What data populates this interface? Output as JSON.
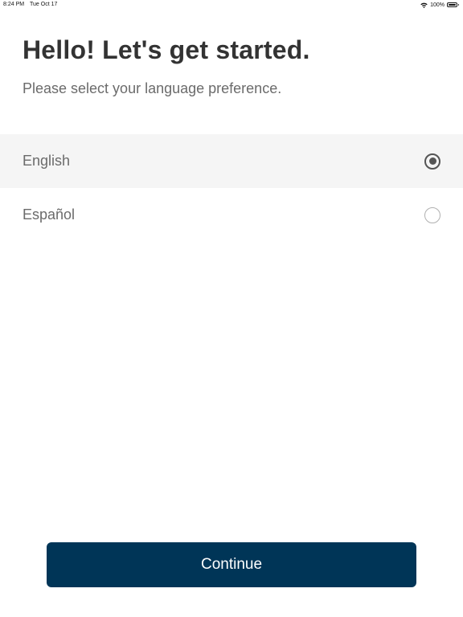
{
  "status_bar": {
    "time": "8:24 PM",
    "date": "Tue Oct 17",
    "battery": "100%",
    "icons": [
      "wifi-icon",
      "battery-icon"
    ]
  },
  "header": {
    "title": "Hello! Let's get started.",
    "subtitle": "Please select your language preference."
  },
  "languages": [
    {
      "label": "English",
      "selected": true
    },
    {
      "label": "Español",
      "selected": false
    }
  ],
  "actions": {
    "continue_label": "Continue"
  },
  "colors": {
    "primary_button": "#003557",
    "selected_row_bg": "#f5f5f5",
    "title_text": "#333333",
    "secondary_text": "#6b6b6b"
  }
}
